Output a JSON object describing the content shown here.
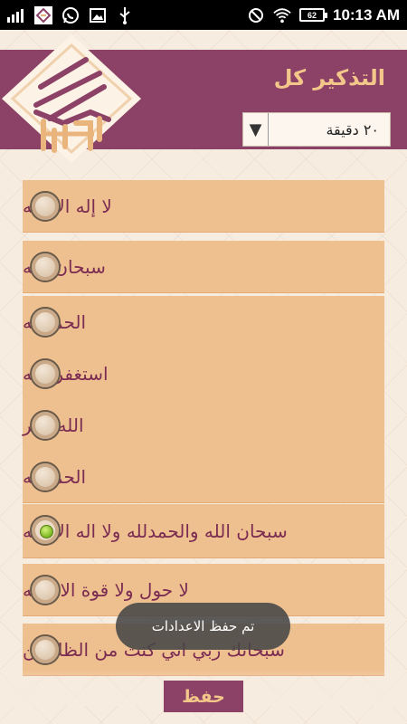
{
  "status_bar": {
    "time": "10:13 AM",
    "battery": "62",
    "icons": [
      "signal-icon",
      "app-icon",
      "whatsapp-icon",
      "gallery-icon",
      "usb-icon",
      "no-sim-icon",
      "wifi-icon",
      "battery-icon"
    ]
  },
  "header": {
    "title": "التذكير كل",
    "interval": "٢٠ دقيقة",
    "dropdown_arrow": "▼"
  },
  "items": [
    {
      "label": "لا إله الا الله",
      "checked": false
    },
    {
      "label": "سبحان الله",
      "checked": false
    },
    {
      "label": "الحمدلله",
      "checked": false
    },
    {
      "label": "استغفر الله",
      "checked": false
    },
    {
      "label": "الله اكبر",
      "checked": false
    },
    {
      "label": "الحمدلله",
      "checked": false
    },
    {
      "label": "سبحان الله والحمدلله ولا اله الا الله",
      "checked": true
    },
    {
      "label": "لا حول ولا قوة الا بالله",
      "checked": false
    },
    {
      "label": "سبحانك ربي اني كنت من الظالمين",
      "checked": false
    }
  ],
  "toast": "تم حفظ الاعدادات",
  "save_label": "حفظ",
  "colors": {
    "header_bg": "#8b4266",
    "title_color": "#f3c68a",
    "item_bg": "#efc08f",
    "item_text": "#7a2c52",
    "radio_checked": "#6fae14"
  }
}
